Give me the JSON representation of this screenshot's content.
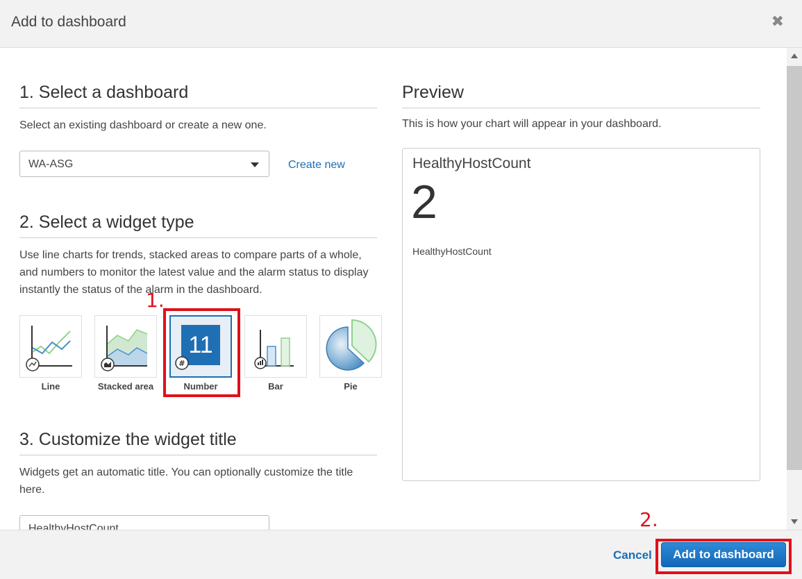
{
  "dialog": {
    "title": "Add to dashboard",
    "close_glyph": "✖"
  },
  "section1": {
    "heading": "1. Select a dashboard",
    "description": "Select an existing dashboard or create a new one.",
    "selected_dashboard": "WA-ASG",
    "create_new_label": "Create new"
  },
  "section2": {
    "heading": "2. Select a widget type",
    "description": "Use line charts for trends, stacked areas to compare parts of a whole, and numbers to monitor the latest value and the alarm status to display instantly the status of the alarm in the dashboard.",
    "widgets": [
      {
        "label": "Line",
        "icon": "line-chart-icon"
      },
      {
        "label": "Stacked area",
        "icon": "stacked-area-icon"
      },
      {
        "label": "Number",
        "icon": "number-icon",
        "selected": true,
        "value": "11"
      },
      {
        "label": "Bar",
        "icon": "bar-chart-icon"
      },
      {
        "label": "Pie",
        "icon": "pie-chart-icon"
      }
    ]
  },
  "section3": {
    "heading": "3. Customize the widget title",
    "description": "Widgets get an automatic title. You can optionally customize the title here.",
    "title_value": "HealthyHostCount"
  },
  "preview": {
    "heading": "Preview",
    "description": "This is how your chart will appear in your dashboard.",
    "widget_title": "HealthyHostCount",
    "value": "2",
    "metric_label": "HealthyHostCount"
  },
  "annotations": {
    "first": "1.",
    "second": "2."
  },
  "footer": {
    "cancel_label": "Cancel",
    "submit_label": "Add to dashboard"
  },
  "colors": {
    "accent": "#1a6fb5",
    "annotation": "#e01019",
    "primary_button": "#1f77c6"
  }
}
